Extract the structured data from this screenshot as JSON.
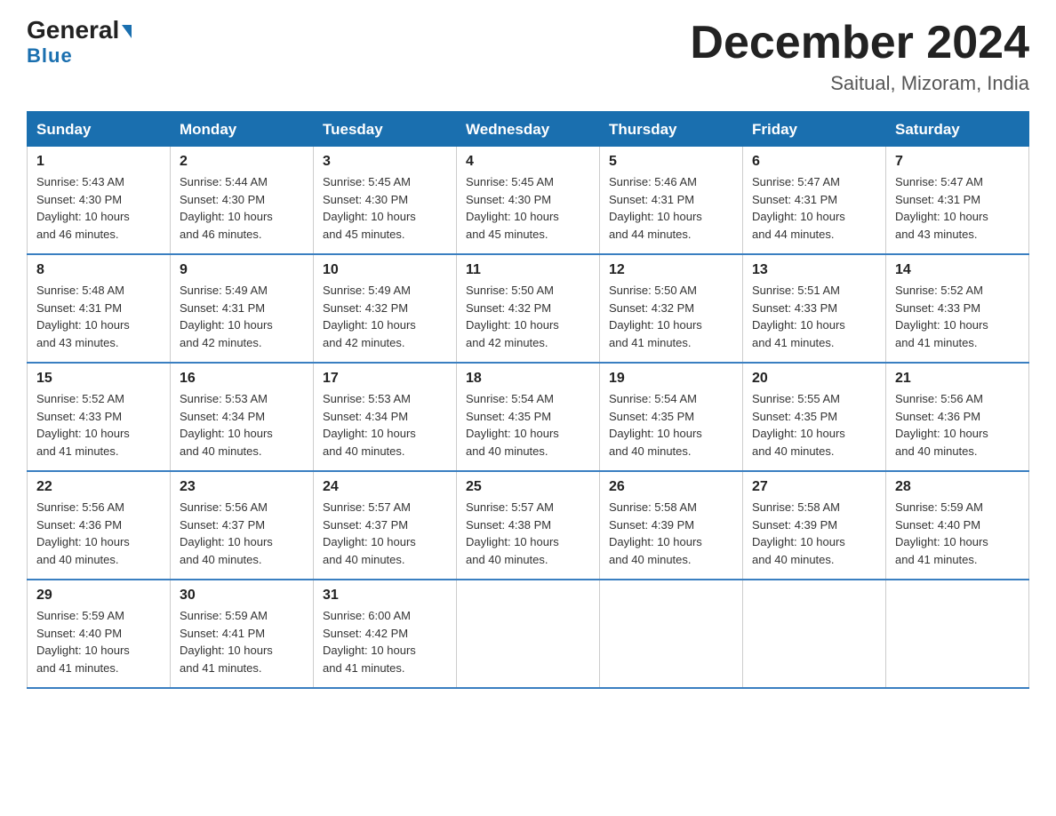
{
  "logo": {
    "general": "General",
    "blue": "Blue"
  },
  "title": "December 2024",
  "subtitle": "Saitual, Mizoram, India",
  "days_of_week": [
    "Sunday",
    "Monday",
    "Tuesday",
    "Wednesday",
    "Thursday",
    "Friday",
    "Saturday"
  ],
  "weeks": [
    [
      {
        "day": "1",
        "sunrise": "5:43 AM",
        "sunset": "4:30 PM",
        "daylight": "10 hours and 46 minutes."
      },
      {
        "day": "2",
        "sunrise": "5:44 AM",
        "sunset": "4:30 PM",
        "daylight": "10 hours and 46 minutes."
      },
      {
        "day": "3",
        "sunrise": "5:45 AM",
        "sunset": "4:30 PM",
        "daylight": "10 hours and 45 minutes."
      },
      {
        "day": "4",
        "sunrise": "5:45 AM",
        "sunset": "4:30 PM",
        "daylight": "10 hours and 45 minutes."
      },
      {
        "day": "5",
        "sunrise": "5:46 AM",
        "sunset": "4:31 PM",
        "daylight": "10 hours and 44 minutes."
      },
      {
        "day": "6",
        "sunrise": "5:47 AM",
        "sunset": "4:31 PM",
        "daylight": "10 hours and 44 minutes."
      },
      {
        "day": "7",
        "sunrise": "5:47 AM",
        "sunset": "4:31 PM",
        "daylight": "10 hours and 43 minutes."
      }
    ],
    [
      {
        "day": "8",
        "sunrise": "5:48 AM",
        "sunset": "4:31 PM",
        "daylight": "10 hours and 43 minutes."
      },
      {
        "day": "9",
        "sunrise": "5:49 AM",
        "sunset": "4:31 PM",
        "daylight": "10 hours and 42 minutes."
      },
      {
        "day": "10",
        "sunrise": "5:49 AM",
        "sunset": "4:32 PM",
        "daylight": "10 hours and 42 minutes."
      },
      {
        "day": "11",
        "sunrise": "5:50 AM",
        "sunset": "4:32 PM",
        "daylight": "10 hours and 42 minutes."
      },
      {
        "day": "12",
        "sunrise": "5:50 AM",
        "sunset": "4:32 PM",
        "daylight": "10 hours and 41 minutes."
      },
      {
        "day": "13",
        "sunrise": "5:51 AM",
        "sunset": "4:33 PM",
        "daylight": "10 hours and 41 minutes."
      },
      {
        "day": "14",
        "sunrise": "5:52 AM",
        "sunset": "4:33 PM",
        "daylight": "10 hours and 41 minutes."
      }
    ],
    [
      {
        "day": "15",
        "sunrise": "5:52 AM",
        "sunset": "4:33 PM",
        "daylight": "10 hours and 41 minutes."
      },
      {
        "day": "16",
        "sunrise": "5:53 AM",
        "sunset": "4:34 PM",
        "daylight": "10 hours and 40 minutes."
      },
      {
        "day": "17",
        "sunrise": "5:53 AM",
        "sunset": "4:34 PM",
        "daylight": "10 hours and 40 minutes."
      },
      {
        "day": "18",
        "sunrise": "5:54 AM",
        "sunset": "4:35 PM",
        "daylight": "10 hours and 40 minutes."
      },
      {
        "day": "19",
        "sunrise": "5:54 AM",
        "sunset": "4:35 PM",
        "daylight": "10 hours and 40 minutes."
      },
      {
        "day": "20",
        "sunrise": "5:55 AM",
        "sunset": "4:35 PM",
        "daylight": "10 hours and 40 minutes."
      },
      {
        "day": "21",
        "sunrise": "5:56 AM",
        "sunset": "4:36 PM",
        "daylight": "10 hours and 40 minutes."
      }
    ],
    [
      {
        "day": "22",
        "sunrise": "5:56 AM",
        "sunset": "4:36 PM",
        "daylight": "10 hours and 40 minutes."
      },
      {
        "day": "23",
        "sunrise": "5:56 AM",
        "sunset": "4:37 PM",
        "daylight": "10 hours and 40 minutes."
      },
      {
        "day": "24",
        "sunrise": "5:57 AM",
        "sunset": "4:37 PM",
        "daylight": "10 hours and 40 minutes."
      },
      {
        "day": "25",
        "sunrise": "5:57 AM",
        "sunset": "4:38 PM",
        "daylight": "10 hours and 40 minutes."
      },
      {
        "day": "26",
        "sunrise": "5:58 AM",
        "sunset": "4:39 PM",
        "daylight": "10 hours and 40 minutes."
      },
      {
        "day": "27",
        "sunrise": "5:58 AM",
        "sunset": "4:39 PM",
        "daylight": "10 hours and 40 minutes."
      },
      {
        "day": "28",
        "sunrise": "5:59 AM",
        "sunset": "4:40 PM",
        "daylight": "10 hours and 41 minutes."
      }
    ],
    [
      {
        "day": "29",
        "sunrise": "5:59 AM",
        "sunset": "4:40 PM",
        "daylight": "10 hours and 41 minutes."
      },
      {
        "day": "30",
        "sunrise": "5:59 AM",
        "sunset": "4:41 PM",
        "daylight": "10 hours and 41 minutes."
      },
      {
        "day": "31",
        "sunrise": "6:00 AM",
        "sunset": "4:42 PM",
        "daylight": "10 hours and 41 minutes."
      },
      null,
      null,
      null,
      null
    ]
  ],
  "labels": {
    "sunrise": "Sunrise:",
    "sunset": "Sunset:",
    "daylight": "Daylight:"
  }
}
